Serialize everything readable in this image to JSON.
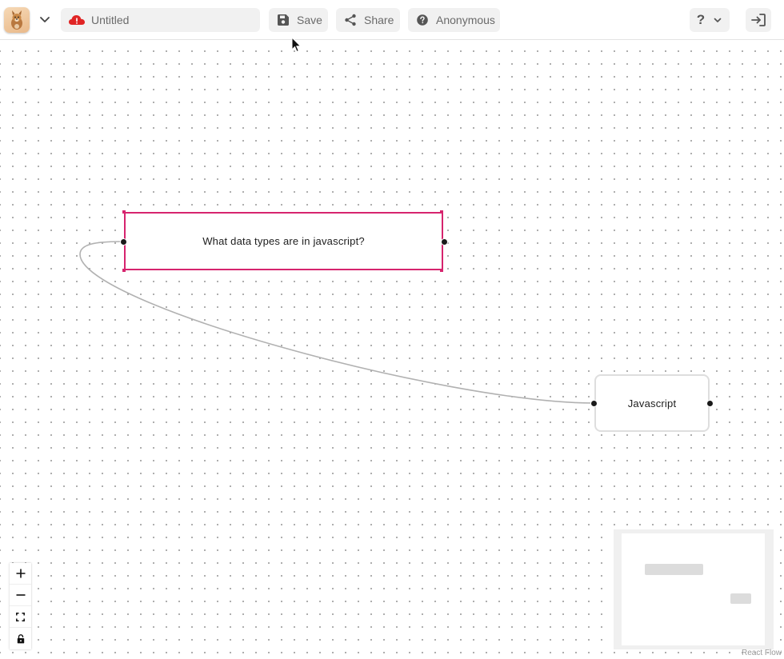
{
  "header": {
    "avatar_alt": "user avatar",
    "title_value": "Untitled",
    "title_placeholder": "Untitled",
    "save_label": "Save",
    "share_label": "Share",
    "user_label": "Anonymous",
    "help_label": "?"
  },
  "nodes": {
    "question": {
      "label": "What data types are in javascript?"
    },
    "topic": {
      "label": "Javascript"
    }
  },
  "controls": [
    "zoom-in",
    "zoom-out",
    "fit-view",
    "toggle-interactivity"
  ],
  "attribution": "React Flow",
  "colors": {
    "selected_border": "#d6246e",
    "edge": "#b1b1b1",
    "cloud_alert": "#e02424"
  }
}
